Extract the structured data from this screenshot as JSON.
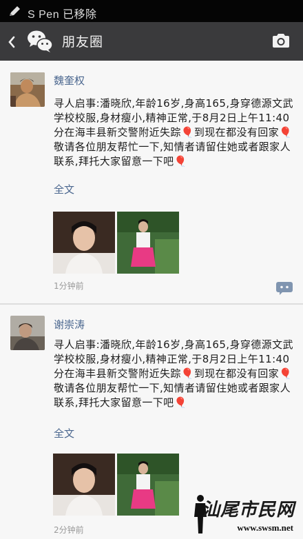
{
  "status_bar": {
    "text": "S Pen 已移除"
  },
  "action_bar": {
    "title": "朋友圈"
  },
  "posts": [
    {
      "username": "魏奎权",
      "text": "寻人启事:潘晓欣,年龄16岁,身高165,身穿德源文武学校校服,身材瘦小,精神正常,于8月2日上午11:40分在海丰县新交警附近失踪🎈到现在都没有回家🎈敬请各位朋友帮忙一下,知情者请留住她或者跟家人联系,拜托大家留意一下吧🎈",
      "full_text_link": "全文",
      "time": "1分钟前"
    },
    {
      "username": "谢崇涛",
      "text": "寻人启事:潘晓欣,年龄16岁,身高165,身穿德源文武学校校服,身材瘦小,精神正常,于8月2日上午11:40分在海丰县新交警附近失踪🎈到现在都没有回家🎈敬请各位朋友帮忙一下,知情者请留住她或者跟家人联系,拜托大家留意一下吧🎈",
      "full_text_link": "全文",
      "time": "2分钟前"
    }
  ],
  "watermark": {
    "brand": "汕尾市民网",
    "url": "www.swsm.net"
  },
  "icons": {
    "pen": "pen-icon",
    "back": "chevron-left-icon",
    "wechat": "wechat-logo-icon",
    "camera": "camera-icon",
    "comment": "comment-icon"
  },
  "colors": {
    "action_bar": "#3a3a3c",
    "link": "#4b678f",
    "status_bar": "#050505"
  }
}
